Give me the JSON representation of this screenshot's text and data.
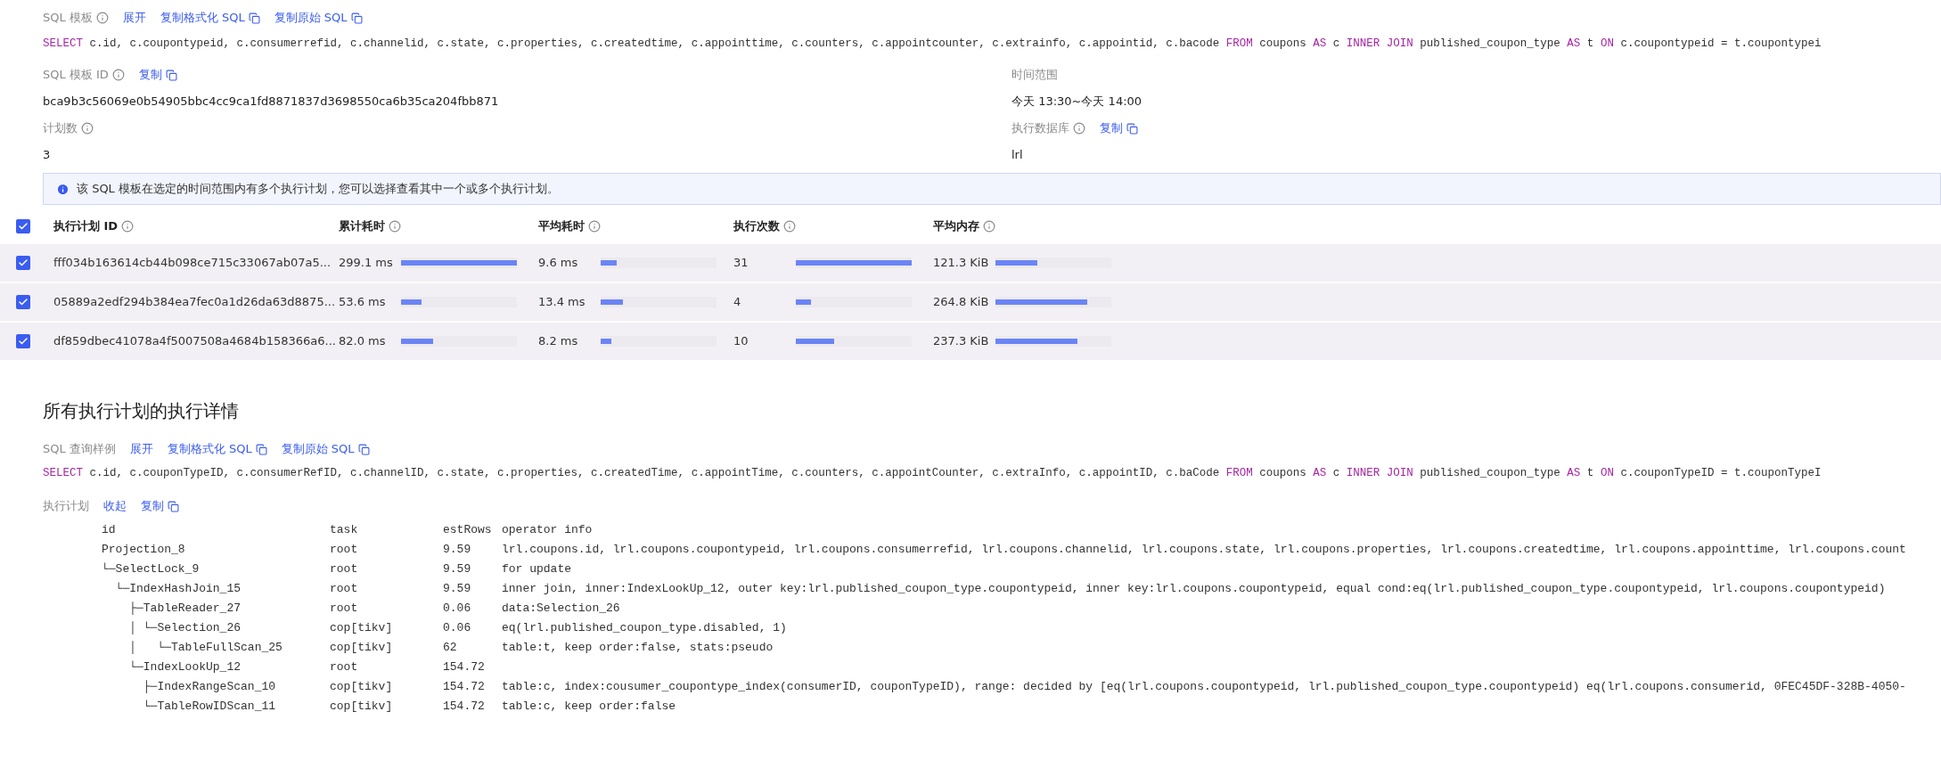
{
  "sql_template": {
    "label": "SQL 模板",
    "actions": [
      "展开",
      "复制格式化 SQL",
      "复制原始 SQL"
    ],
    "tokens": [
      {
        "kind": "keyword",
        "text": "SELECT"
      },
      {
        "kind": "plain",
        "text": " c.id, c.coupontypeid, c.consumerrefid, c.channelid, c.state, c.properties, c.createdtime, c.appointtime, c.counters, c.appointcounter, c.extrainfo, c.appointid, c.bacode "
      },
      {
        "kind": "keyword",
        "text": "FROM"
      },
      {
        "kind": "plain",
        "text": " coupons "
      },
      {
        "kind": "keyword",
        "text": "AS"
      },
      {
        "kind": "plain",
        "text": " c "
      },
      {
        "kind": "keyword",
        "text": "INNER JOIN"
      },
      {
        "kind": "plain",
        "text": " published_coupon_type "
      },
      {
        "kind": "keyword",
        "text": "AS"
      },
      {
        "kind": "plain",
        "text": " t "
      },
      {
        "kind": "keyword",
        "text": "ON"
      },
      {
        "kind": "plain",
        "text": " c.coupontypeid = t.coupontypei"
      }
    ]
  },
  "fields": [
    {
      "label": "SQL 模板 ID",
      "info": true,
      "action": "复制",
      "value": "bca9b3c56069e0b54905bbc4cc9ca1fd8871837d3698550ca6b35ca204fbb871"
    },
    {
      "label": "时间范围",
      "info": false,
      "value": "今天 13:30~今天 14:00"
    },
    {
      "label": "计划数",
      "info": true,
      "value": "3"
    },
    {
      "label": "执行数据库",
      "info": true,
      "action": "复制",
      "value": "lrl"
    }
  ],
  "alert": "该 SQL 模板在选定的时间范围内有多个执行计划，您可以选择查看其中一个或多个执行计划。",
  "plans_table": {
    "all_checked": true,
    "columns": [
      "执行计划 ID",
      "累计耗时",
      "平均耗时",
      "执行次数",
      "平均内存"
    ],
    "rows": [
      {
        "checked": true,
        "id": "fff034b163614cb44b098ce715c33067ab07a5...",
        "total_latency": {
          "text": "299.1 ms",
          "level": 1.0
        },
        "avg_latency": {
          "text": "9.6 ms",
          "level": 0.14
        },
        "exec_count": {
          "text": "31",
          "level": 1.0
        },
        "avg_mem": {
          "text": "121.3 KiB",
          "level": 0.36
        }
      },
      {
        "checked": true,
        "id": "05889a2edf294b384ea7fec0a1d26da63d8875...",
        "total_latency": {
          "text": "53.6 ms",
          "level": 0.18
        },
        "avg_latency": {
          "text": "13.4 ms",
          "level": 0.19
        },
        "exec_count": {
          "text": "4",
          "level": 0.13
        },
        "avg_mem": {
          "text": "264.8 KiB",
          "level": 0.79
        }
      },
      {
        "checked": true,
        "id": "df859dbec41078a4f5007508a4684b158366a6...",
        "total_latency": {
          "text": "82.0 ms",
          "level": 0.28
        },
        "avg_latency": {
          "text": "8.2 ms",
          "level": 0.09
        },
        "exec_count": {
          "text": "10",
          "level": 0.33
        },
        "avg_mem": {
          "text": "237.3 KiB",
          "level": 0.71
        }
      }
    ]
  },
  "details_heading": "所有执行计划的执行详情",
  "sql_sample": {
    "label": "SQL 查询样例",
    "actions": [
      "展开",
      "复制格式化 SQL",
      "复制原始 SQL"
    ],
    "tokens": [
      {
        "kind": "keyword",
        "text": "SELECT"
      },
      {
        "kind": "plain",
        "text": " c.id, c.couponTypeID, c.consumerRefID, c.channelID, c.state, c.properties, c.createdTime, c.appointTime, c.counters, c.appointCounter, c.extraInfo, c.appointID, c.baCode "
      },
      {
        "kind": "keyword",
        "text": "FROM"
      },
      {
        "kind": "plain",
        "text": " coupons "
      },
      {
        "kind": "keyword",
        "text": "AS"
      },
      {
        "kind": "plain",
        "text": " c "
      },
      {
        "kind": "keyword",
        "text": "INNER JOIN"
      },
      {
        "kind": "plain",
        "text": " published_coupon_type "
      },
      {
        "kind": "keyword",
        "text": "AS"
      },
      {
        "kind": "plain",
        "text": " t "
      },
      {
        "kind": "keyword",
        "text": "ON"
      },
      {
        "kind": "plain",
        "text": " c.couponTypeID = t.couponTypeI"
      }
    ]
  },
  "execution_plan": {
    "label": "执行计划",
    "actions": [
      "收起",
      "复制"
    ],
    "columns": [
      "id",
      "task",
      "estRows",
      "operator info"
    ],
    "rows": [
      {
        "id": "Projection_8",
        "task": "root",
        "est_rows": "9.59",
        "operator_info": "lrl.coupons.id, lrl.coupons.coupontypeid, lrl.coupons.consumerrefid, lrl.coupons.channelid, lrl.coupons.state, lrl.coupons.properties, lrl.coupons.createdtime, lrl.coupons.appointtime, lrl.coupons.count"
      },
      {
        "id": "└─SelectLock_9",
        "task": "root",
        "est_rows": "9.59",
        "operator_info": "for update"
      },
      {
        "id": "  └─IndexHashJoin_15",
        "task": "root",
        "est_rows": "9.59",
        "operator_info": "inner join, inner:IndexLookUp_12, outer key:lrl.published_coupon_type.coupontypeid, inner key:lrl.coupons.coupontypeid, equal cond:eq(lrl.published_coupon_type.coupontypeid, lrl.coupons.coupontypeid)"
      },
      {
        "id": "    ├─TableReader_27",
        "task": "root",
        "est_rows": "0.06",
        "operator_info": "data:Selection_26"
      },
      {
        "id": "    │ └─Selection_26",
        "task": "cop[tikv]",
        "est_rows": "0.06",
        "operator_info": "eq(lrl.published_coupon_type.disabled, 1)"
      },
      {
        "id": "    │   └─TableFullScan_25",
        "task": "cop[tikv]",
        "est_rows": "62",
        "operator_info": "table:t, keep order:false, stats:pseudo"
      },
      {
        "id": "    └─IndexLookUp_12",
        "task": "root",
        "est_rows": "154.72"
      },
      {
        "id": "      ├─IndexRangeScan_10",
        "task": "cop[tikv]",
        "est_rows": "154.72",
        "operator_info": "table:c, index:cousumer_coupontype_index(consumerID, couponTypeID), range: decided by [eq(lrl.coupons.coupontypeid, lrl.published_coupon_type.coupontypeid) eq(lrl.coupons.consumerid, 0FEC45DF-328B-4050-"
      },
      {
        "id": "      └─TableRowIDScan_11",
        "task": "cop[tikv]",
        "est_rows": "154.72",
        "operator_info": "table:c, keep order:false"
      }
    ]
  }
}
